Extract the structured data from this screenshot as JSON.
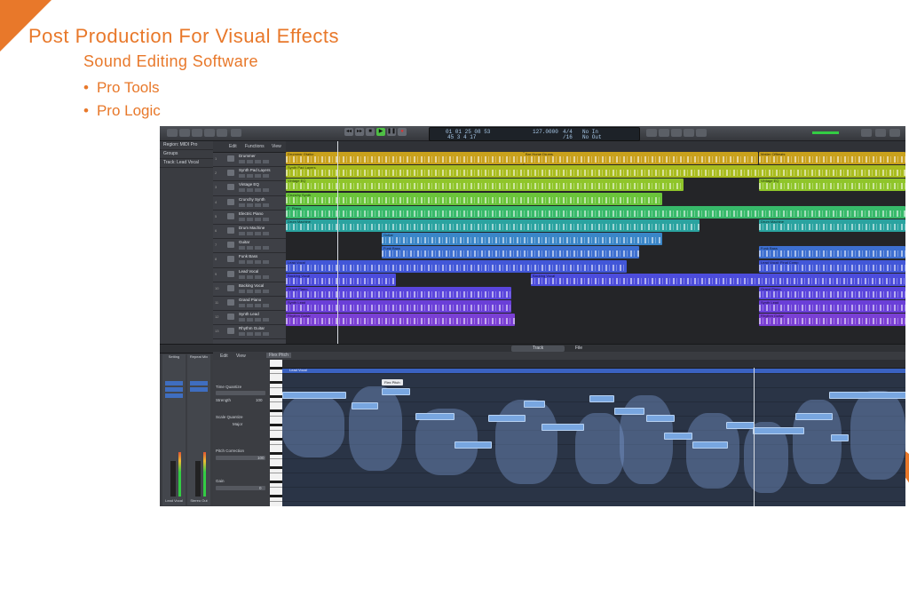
{
  "slide": {
    "title": "Post Production  For Visual Effects",
    "subtitle": "Sound Editing Software",
    "bullets": [
      "Pro Tools",
      "Pro Logic"
    ],
    "accent_color": "#e8782a"
  },
  "app": {
    "lcd": {
      "position": "01 01 25 08 53",
      "bars": "45  3  4  17",
      "tempo": "127.0000",
      "signature": "4/4",
      "division": "/16",
      "in_label": "No In",
      "out_label": "No Out"
    },
    "inspector": {
      "rows": [
        "Region: MIDI Pro",
        "Groups",
        "Track: Lead Vocal"
      ],
      "channels": [
        {
          "label": "Setting",
          "bottom": "Lead Vocal"
        },
        {
          "label": "Repeat Mix",
          "bottom": "Stereo Out"
        }
      ],
      "channel_labels": [
        "Setting",
        "Repeat Mix"
      ],
      "channel_bottom": [
        "Lead Vocal",
        "Stereo Out"
      ]
    },
    "arrange_menu": {
      "edit": "Edit",
      "functions": "Functions",
      "view": "View"
    },
    "tracks": [
      {
        "num": "1",
        "name": "Drummer"
      },
      {
        "num": "2",
        "name": "Synth Pad Layers"
      },
      {
        "num": "3",
        "name": "Vintage EQ"
      },
      {
        "num": "4",
        "name": "Crunchy Synth"
      },
      {
        "num": "5",
        "name": "Electric Piano"
      },
      {
        "num": "6",
        "name": "Drum Machine"
      },
      {
        "num": "7",
        "name": "Guitar"
      },
      {
        "num": "8",
        "name": "Funk Bass"
      },
      {
        "num": "9",
        "name": "Lead Vocal"
      },
      {
        "num": "10",
        "name": "Backing Vocal"
      },
      {
        "num": "11",
        "name": "Grand Piano"
      },
      {
        "num": "12",
        "name": "Synth Lead"
      },
      {
        "num": "13",
        "name": "Rhythm Guitar"
      }
    ],
    "regions": {
      "drummer_a": "Drummer Gtaiko",
      "drummer_b": "Bar Home Drums",
      "drummer_c": "Matter Offbeats",
      "synthpad": "Synth Pad Layers",
      "vintage": "Vintage EQ",
      "crunchy": "Crunchy Synth",
      "epiano": "E. Piano",
      "drummachine": "Drum Machine",
      "guitar": "Guitar",
      "funkbass": "Funk Bass",
      "leadvocal": "Lead Vocal",
      "leadvocal_comp": "Lead Vocal: Final Comp",
      "backing_a": "Backing Vocal",
      "backing_b": "Backing Vocal",
      "grandpiano": "Grand Piano",
      "synthlead": "Synth Lead",
      "rhythmguitar": "Rhythm Guitar"
    },
    "editor_tabs": [
      "Track",
      "File"
    ],
    "editor": {
      "edit": "Edit",
      "view": "View",
      "flex_mode": "Flex Pitch",
      "region_name": "Lead Vocal",
      "time_quantize_label": "Time Quantize",
      "strength_label": "Strength",
      "strength_value": "100",
      "scale_quantize_label": "Scale Quantize",
      "scale_value": "Major",
      "pitch_correction_label": "Pitch Correction",
      "pitch_value": "100",
      "gain_label": "Gain",
      "gain_value": "0",
      "tooltip": "Flex Pitch"
    }
  }
}
